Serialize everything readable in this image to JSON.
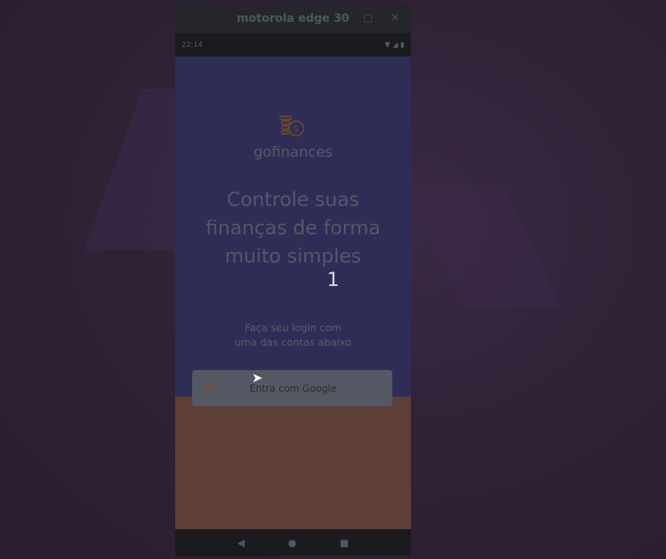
{
  "window": {
    "title": "motorola edge 30",
    "minimize": "–",
    "maximize": "□",
    "close": "✕"
  },
  "statusbar": {
    "time": "22:14",
    "icons": [
      "wifi-icon",
      "signal-icon",
      "battery-icon"
    ]
  },
  "app": {
    "brand": "gofinances",
    "title_lines": [
      "Controle suas",
      "finanças de forma",
      "muito simples"
    ],
    "overlay_number": "1",
    "subtitle_lines": [
      "Faça seu login com",
      "uma das contas abaixo"
    ],
    "google_button": "Entra com Google",
    "google_icon": "G"
  },
  "navbar": {
    "back": "◀",
    "home": "●",
    "recents": "■"
  },
  "colors": {
    "header": "#2e2d55",
    "footer": "#5d3f38",
    "button": "#545862"
  }
}
